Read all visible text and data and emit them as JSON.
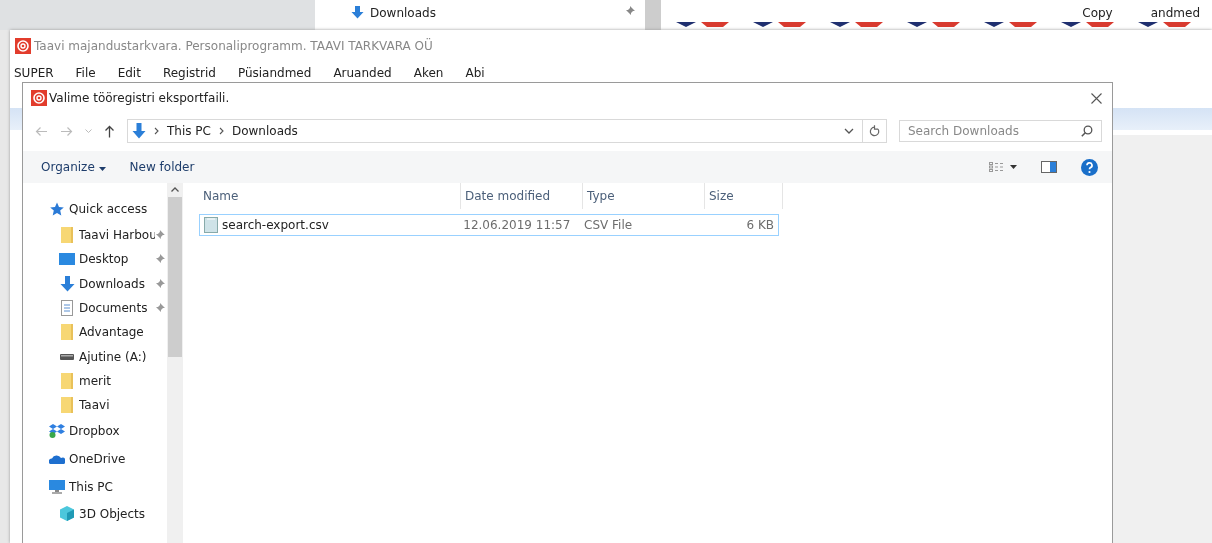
{
  "background": {
    "nav_item": "Downloads",
    "right_labels": [
      "Copy",
      "andmed"
    ]
  },
  "app_window": {
    "title": "Taavi majandustarkvara. Personaliprogramm. TAAVI TARKVARA OÜ",
    "menu": [
      "SUPER",
      "File",
      "Edit",
      "Registrid",
      "Püsiandmed",
      "Aruanded",
      "Aken",
      "Abi"
    ]
  },
  "dialog": {
    "title": "Valime tööregistri eksportfaili.",
    "breadcrumb": [
      "This PC",
      "Downloads"
    ],
    "search": {
      "placeholder": "Search Downloads"
    },
    "toolbar": [
      "Organize",
      "New folder"
    ],
    "sidebar": [
      {
        "label": "Quick access",
        "kind": "star",
        "children": [
          {
            "label": "Taavi Harbou",
            "kind": "folder",
            "pinned": true
          },
          {
            "label": "Desktop",
            "kind": "desktop",
            "pinned": true
          },
          {
            "label": "Downloads",
            "kind": "download",
            "pinned": true
          },
          {
            "label": "Documents",
            "kind": "document",
            "pinned": true
          },
          {
            "label": "Advantage",
            "kind": "folder",
            "pinned": false
          },
          {
            "label": "Ajutine (A:)",
            "kind": "drive",
            "pinned": false
          },
          {
            "label": "merit",
            "kind": "folder",
            "pinned": false
          },
          {
            "label": "Taavi",
            "kind": "folder",
            "pinned": false
          }
        ]
      },
      {
        "label": "Dropbox",
        "kind": "dropbox"
      },
      {
        "label": "OneDrive",
        "kind": "cloud"
      },
      {
        "label": "This PC",
        "kind": "pc",
        "children": [
          {
            "label": "3D Objects",
            "kind": "cube",
            "pinned": false
          }
        ]
      }
    ],
    "columns": [
      "Name",
      "Date modified",
      "Type",
      "Size"
    ],
    "rows": [
      {
        "name": "search-export.csv",
        "date": "12.06.2019 11:57",
        "type": "CSV File",
        "size": "6 KB",
        "selected": true
      }
    ]
  }
}
